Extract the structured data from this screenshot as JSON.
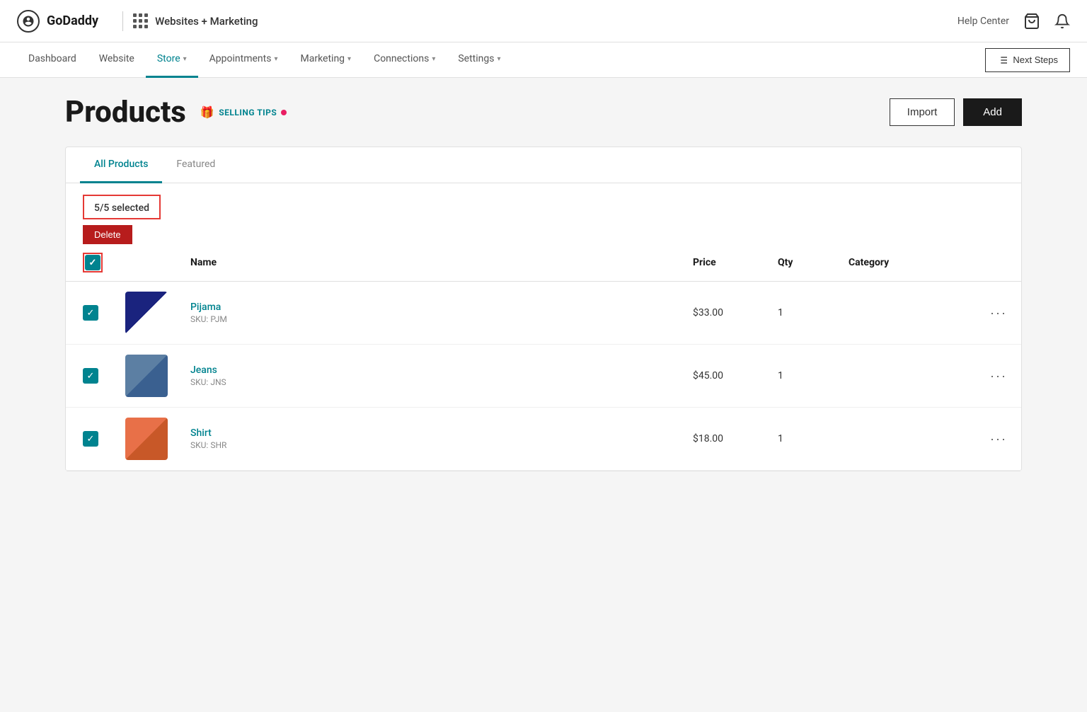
{
  "topbar": {
    "logo_text": "GoDaddy",
    "brand": "Websites + Marketing",
    "help_center": "Help Center"
  },
  "secondary_nav": {
    "items": [
      {
        "label": "Dashboard",
        "active": false,
        "has_dropdown": false
      },
      {
        "label": "Website",
        "active": false,
        "has_dropdown": false
      },
      {
        "label": "Store",
        "active": true,
        "has_dropdown": true
      },
      {
        "label": "Appointments",
        "active": false,
        "has_dropdown": true
      },
      {
        "label": "Marketing",
        "active": false,
        "has_dropdown": true
      },
      {
        "label": "Connections",
        "active": false,
        "has_dropdown": true
      },
      {
        "label": "Settings",
        "active": false,
        "has_dropdown": true
      }
    ],
    "next_steps_label": "Next Steps"
  },
  "page": {
    "title": "Products",
    "selling_tips_label": "Selling Tips",
    "import_label": "Import",
    "add_label": "Add"
  },
  "tabs": [
    {
      "label": "All Products",
      "active": true
    },
    {
      "label": "Featured",
      "active": false
    }
  ],
  "selection": {
    "count_label": "5/5 selected",
    "delete_label": "Delete"
  },
  "table": {
    "columns": {
      "name": "Name",
      "price": "Price",
      "qty": "Qty",
      "category": "Category"
    },
    "products": [
      {
        "name": "Pijama",
        "sku": "SKU: PJM",
        "price": "$33.00",
        "qty": "1",
        "category": "",
        "thumb_class": "thumb-pijama",
        "checked": true
      },
      {
        "name": "Jeans",
        "sku": "SKU: JNS",
        "price": "$45.00",
        "qty": "1",
        "category": "",
        "thumb_class": "thumb-jeans",
        "checked": true
      },
      {
        "name": "Shirt",
        "sku": "SKU: SHR",
        "price": "$18.00",
        "qty": "1",
        "category": "",
        "thumb_class": "thumb-shirt",
        "checked": true
      }
    ]
  }
}
